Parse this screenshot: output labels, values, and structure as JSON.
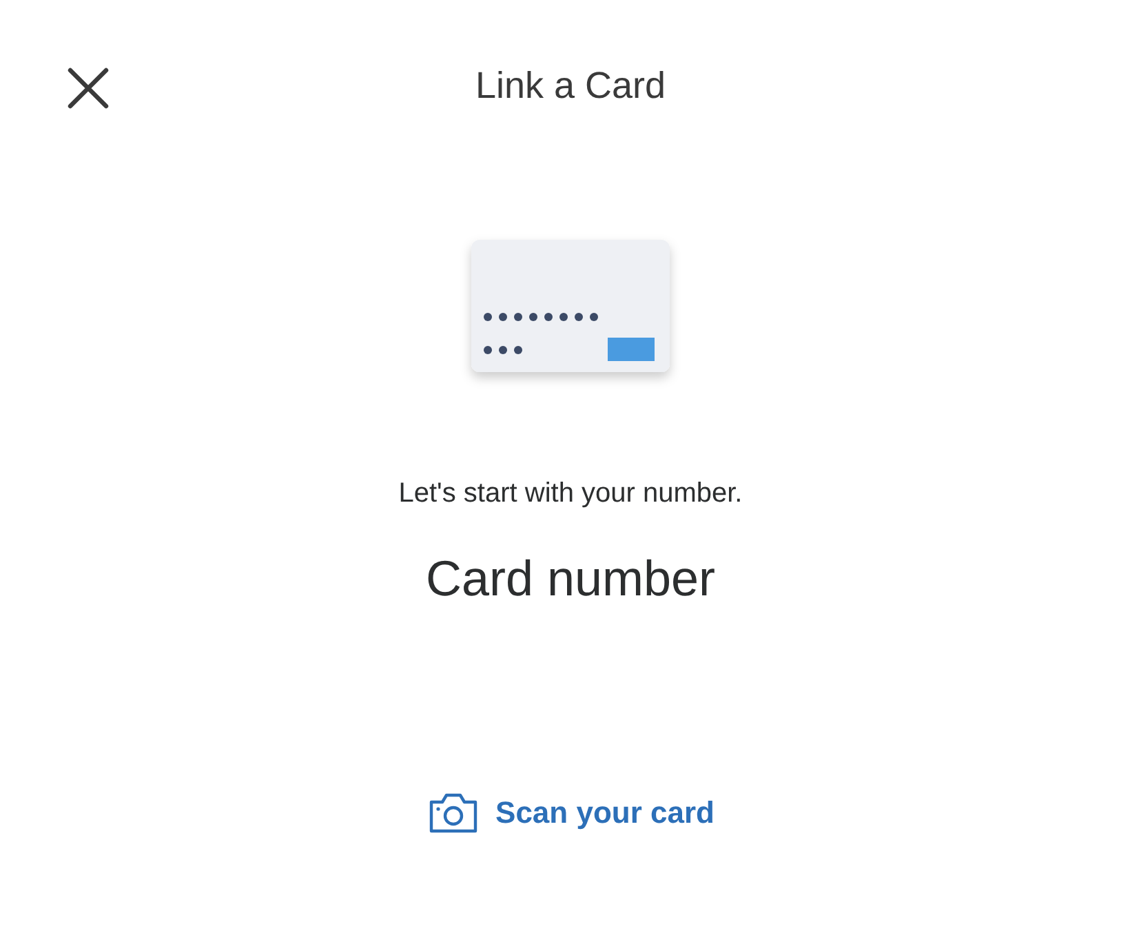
{
  "header": {
    "title": "Link a Card"
  },
  "prompt": "Let's start with your number.",
  "card_field": {
    "placeholder": "Card number"
  },
  "scan_link": {
    "label": "Scan your card"
  }
}
